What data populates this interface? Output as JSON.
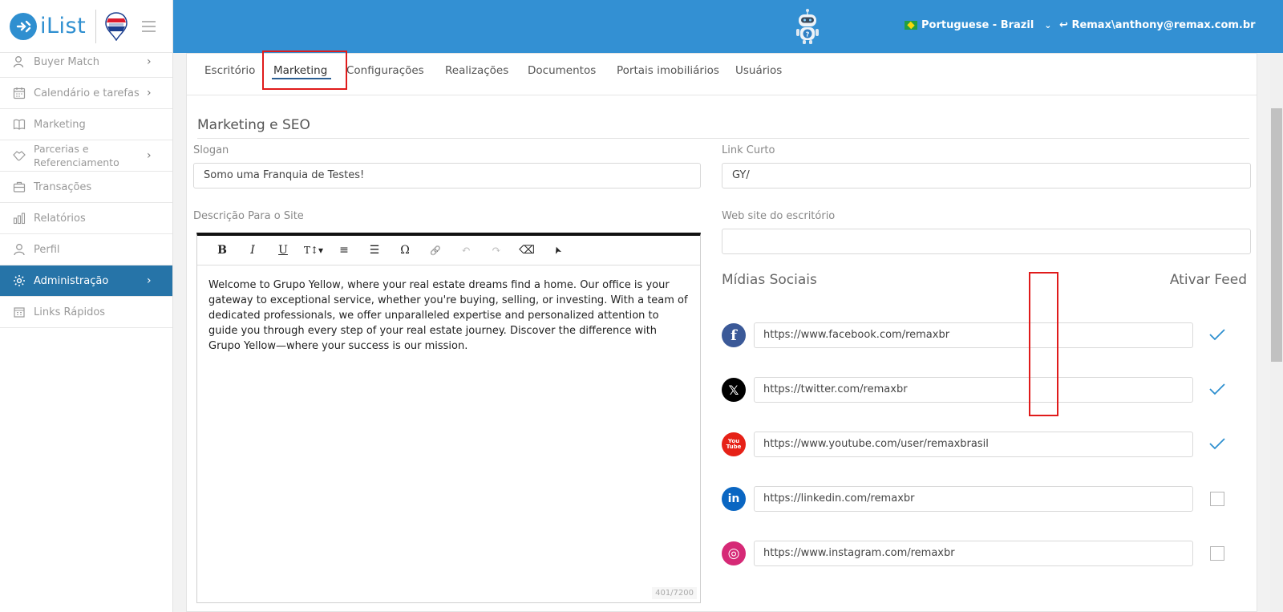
{
  "brand": {
    "logo_text": "iList",
    "partner_logo": "remax-balloon"
  },
  "sidebar": {
    "items": [
      {
        "label": "Buyer Match",
        "icon": "person-search-icon",
        "chevron": true,
        "active": false
      },
      {
        "label": "Calendário e tarefas",
        "icon": "calendar-icon",
        "chevron": true,
        "active": false
      },
      {
        "label": "Marketing",
        "icon": "book-icon",
        "chevron": false,
        "active": false
      },
      {
        "label": "Parcerias e Referenciamento",
        "icon": "handshake-icon",
        "chevron": true,
        "active": false
      },
      {
        "label": "Transações",
        "icon": "briefcase-icon",
        "chevron": false,
        "active": false
      },
      {
        "label": "Relatórios",
        "icon": "bar-chart-icon",
        "chevron": false,
        "active": false
      },
      {
        "label": "Perfil",
        "icon": "user-icon",
        "chevron": false,
        "active": false
      },
      {
        "label": "Administração",
        "icon": "gear-icon",
        "chevron": true,
        "active": true
      },
      {
        "label": "Links Rápidos",
        "icon": "building-icon",
        "chevron": false,
        "active": false
      }
    ]
  },
  "topbar": {
    "language": "Portuguese - Brazil",
    "user": "Remax\\anthony@remax.com.br"
  },
  "tabs": [
    {
      "label": "Escritório",
      "active": false
    },
    {
      "label": "Marketing",
      "active": true
    },
    {
      "label": "Configurações",
      "active": false
    },
    {
      "label": "Realizações",
      "active": false
    },
    {
      "label": "Documentos",
      "active": false
    },
    {
      "label": "Portais imobiliários",
      "active": false
    },
    {
      "label": "Usuários",
      "active": false
    }
  ],
  "form": {
    "section_title": "Marketing e SEO",
    "slogan_label": "Slogan",
    "slogan_value": "Somo uma Franquia de Testes!",
    "short_link_label": "Link Curto",
    "short_link_value": "GY/",
    "description_label": "Descrição Para o Site",
    "website_label": "Web site do escritório",
    "website_value": "",
    "description_text": "Welcome to Grupo Yellow, where your real estate dreams find a home. Our office is your gateway to exceptional service, whether you're buying, selling, or investing. With a team of dedicated professionals, we offer unparalleled expertise and personalized attention to guide you through every step of your real estate journey. Discover the difference with Grupo Yellow—where your success is our mission.",
    "char_counter": "401/7200"
  },
  "editor_toolbar": [
    {
      "glyph": "B",
      "icon": "bold-icon"
    },
    {
      "glyph": "I",
      "icon": "italic-icon"
    },
    {
      "glyph": "U",
      "icon": "underline-icon"
    },
    {
      "glyph": "T↕▾",
      "icon": "font-size-icon"
    },
    {
      "glyph": "≡",
      "icon": "ordered-list-icon"
    },
    {
      "glyph": "☰",
      "icon": "unordered-list-icon"
    },
    {
      "glyph": "Ω",
      "icon": "special-char-icon"
    },
    {
      "glyph": "🔗",
      "icon": "link-icon"
    },
    {
      "glyph": "↶",
      "icon": "undo-icon"
    },
    {
      "glyph": "↷",
      "icon": "redo-icon"
    },
    {
      "glyph": "⌫",
      "icon": "eraser-icon"
    },
    {
      "glyph": "➤",
      "icon": "pointer-icon"
    }
  ],
  "social": {
    "title": "Mídias Sociais",
    "feed_title": "Ativar Feed",
    "items": [
      {
        "network": "facebook",
        "icon": "facebook-icon",
        "glyph": "f",
        "color": "#3b5998",
        "url": "https://www.facebook.com/remaxbr",
        "feed": true
      },
      {
        "network": "x",
        "icon": "x-twitter-icon",
        "glyph": "𝕏",
        "color": "#000000",
        "url": "https://twitter.com/remaxbr",
        "feed": true
      },
      {
        "network": "youtube",
        "icon": "youtube-icon",
        "glyph": "You Tube",
        "color": "#e62117",
        "url": "https://www.youtube.com/user/remaxbrasil",
        "feed": true
      },
      {
        "network": "linkedin",
        "icon": "linkedin-icon",
        "glyph": "in",
        "color": "#0a66c2",
        "url": "https://linkedin.com/remaxbr",
        "feed": false
      },
      {
        "network": "instagram",
        "icon": "instagram-icon",
        "glyph": "◎",
        "color": "#d62976",
        "url": "https://www.instagram.com/remaxbr",
        "feed": false
      }
    ]
  },
  "colors": {
    "topbar": "#3390d3",
    "sidebar_active": "#2674a8",
    "highlight": "#e01b1b",
    "check": "#2d8fcf"
  }
}
